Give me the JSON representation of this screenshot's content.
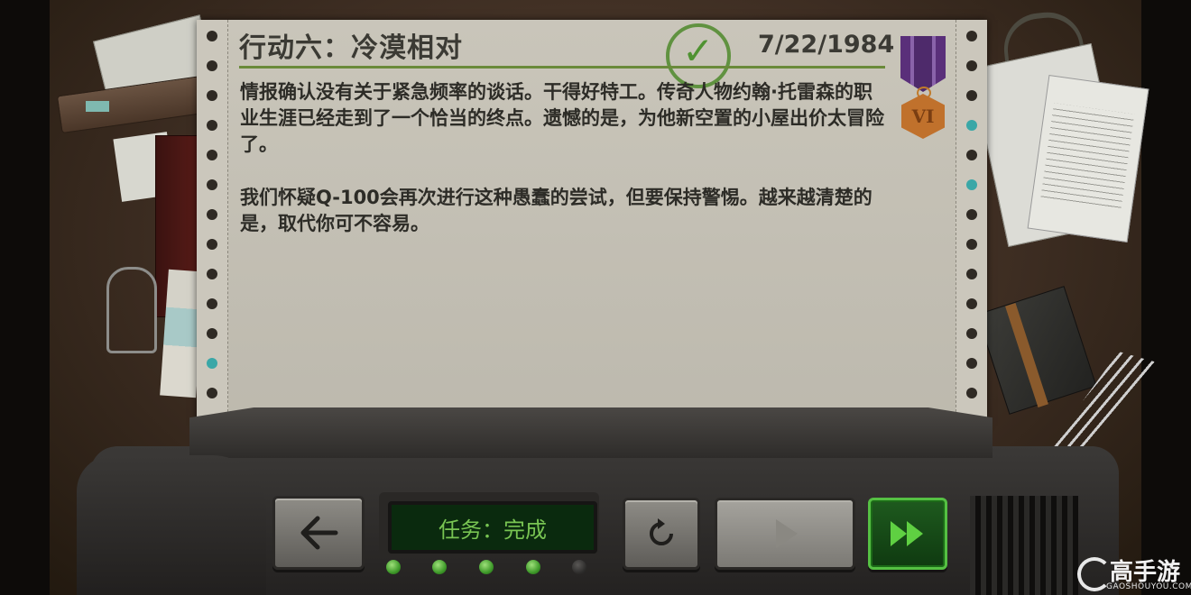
{
  "report": {
    "title": "行动六：冷漠相对",
    "date": "7/22/1984",
    "paragraphs": [
      "情报确认没有关于紧急频率的谈话。干得好特工。传奇人物约翰·托雷森的职业生涯已经走到了一个恰当的终点。遗憾的是，为他新空置的小屋出价太冒险了。",
      "我们怀疑Q-100会再次进行这种愚蠢的尝试，但要保持警惕。越来越清楚的是，取代你可不容易。"
    ],
    "stamp_icon": "checkmark-icon",
    "medal_rank": "VI"
  },
  "console": {
    "status_text": "任务：完成",
    "back_icon": "arrow-left-icon",
    "retry_icon": "restart-icon",
    "play_icon": "play-icon",
    "fast_forward_icon": "fast-forward-icon",
    "progress_lights": [
      true,
      true,
      true,
      true,
      false
    ]
  },
  "watermark": {
    "title": "高手游",
    "subtitle": "GAOSHOUYOU.COM"
  },
  "colors": {
    "status_text": "#78c452",
    "accent_green": "#55c043",
    "medal_bronze": "#c0712c",
    "ribbon_purple": "#4e2a6b"
  }
}
